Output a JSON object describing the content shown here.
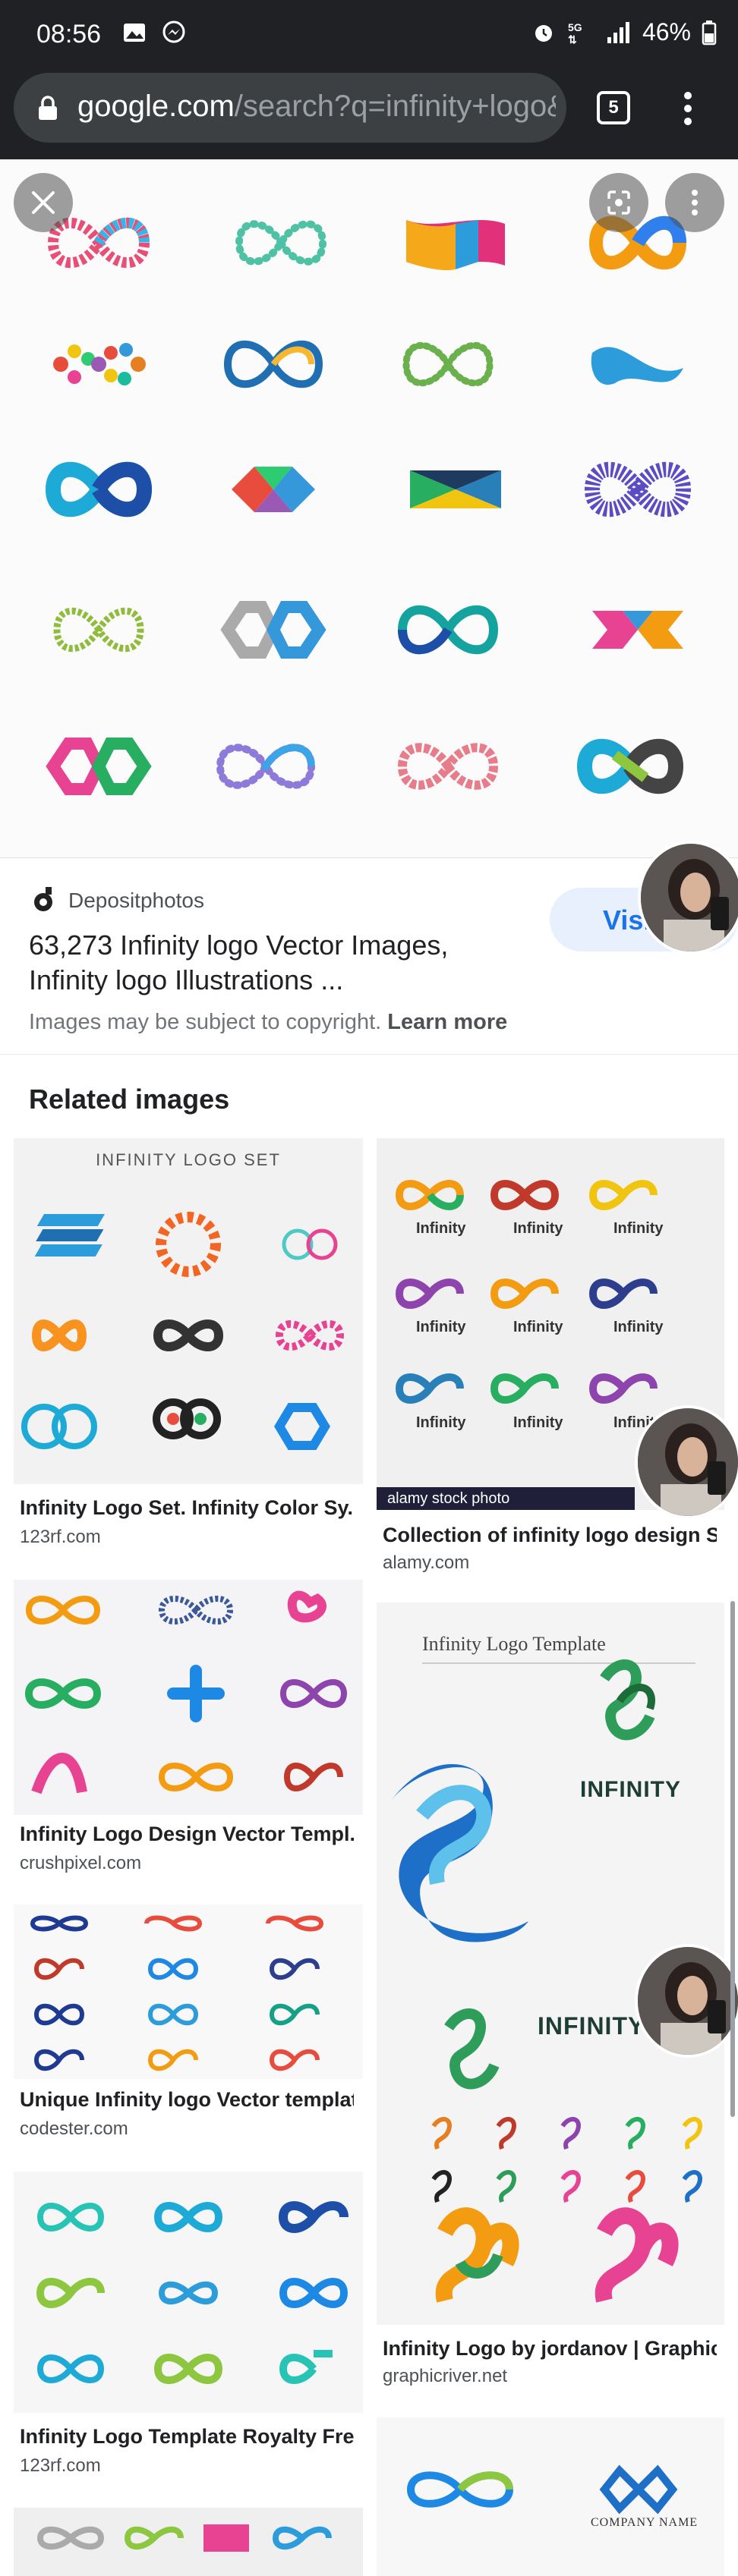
{
  "status_bar": {
    "time": "08:56",
    "left_icons": [
      "gallery-icon",
      "messenger-icon"
    ],
    "right_icons": [
      "alarm-icon",
      "5g-icon",
      "signal-icon"
    ],
    "battery": "46%"
  },
  "browser": {
    "url_host": "google.com",
    "url_path": "/search?q=infinity+logo&",
    "tab_count": "5"
  },
  "viewer": {
    "close_icon": "close-icon",
    "lens_icon": "lens-icon",
    "more_icon": "more-vert-icon"
  },
  "source": {
    "site": "Depositphotos",
    "title": "63,273 Infinity logo Vector Images, Infinity logo Illustrations ...",
    "copyright": "Images may be subject to copyright.",
    "learn_more": "Learn more",
    "visit": "Visit"
  },
  "related": {
    "heading": "Related images",
    "left_column": [
      {
        "title": "Infinity Logo Set. Infinity Color Sy...",
        "site": "123rf.com",
        "img_text": "INFINITY LOGO SET"
      },
      {
        "title": "Infinity Logo Design Vector Templ...",
        "site": "crushpixel.com"
      },
      {
        "title": "Unique Infinity logo Vector templat...",
        "site": "codester.com"
      },
      {
        "title": "Infinity Logo Template Royalty Fre...",
        "site": "123rf.com"
      }
    ],
    "right_column": [
      {
        "title": "Collection of infinity logo design St...",
        "site": "alamy.com",
        "img_text": "alamy stock photo",
        "logo_word": "Infinity"
      },
      {
        "title": "Infinity Logo by jordanov | Graphic...",
        "site": "graphicriver.net",
        "img_text": "Infinity Logo Template",
        "logo_word": "INFINITY"
      },
      {
        "title": "",
        "site": "",
        "img_text": "COMPANY NAME"
      }
    ]
  },
  "colors": {
    "chrome_bg": "#202124",
    "link_blue": "#1a73e8",
    "visit_bg": "#e8f0fe"
  }
}
